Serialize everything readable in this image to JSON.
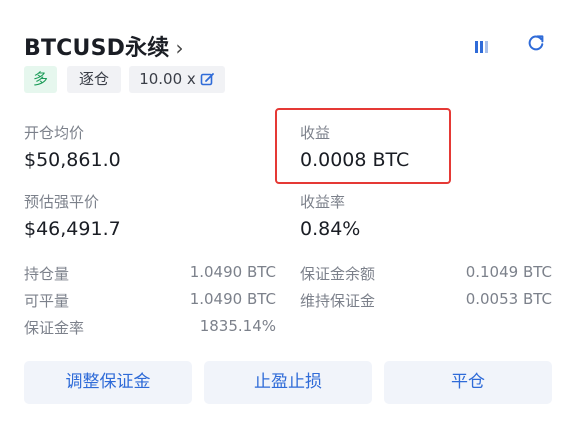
{
  "header": {
    "title": "BTCUSD永续",
    "chevron": "›"
  },
  "tags": {
    "side": "多",
    "margin_mode": "逐仓",
    "leverage": "10.00 x"
  },
  "stats": {
    "open_price_label": "开仓均价",
    "open_price_value": "$50,861.0",
    "pnl_label": "收益",
    "pnl_value": "0.0008 BTC",
    "liq_price_label": "预估强平价",
    "liq_price_value": "$46,491.7",
    "pnl_rate_label": "收益率",
    "pnl_rate_value": "0.84%"
  },
  "details": {
    "position_label": "持仓量",
    "position_value": "1.0490 BTC",
    "closable_label": "可平量",
    "closable_value": "1.0490 BTC",
    "margin_ratio_label": "保证金率",
    "margin_ratio_value": "1835.14%",
    "margin_balance_label": "保证金余额",
    "margin_balance_value": "0.1049 BTC",
    "maint_margin_label": "维持保证金",
    "maint_margin_value": "0.0053 BTC"
  },
  "actions": {
    "adjust_margin": "调整保证金",
    "tp_sl": "止盈止损",
    "close": "平仓"
  },
  "icons": {
    "pause": "pause-bars-icon",
    "refresh": "refresh-icon",
    "edit": "edit-icon"
  },
  "colors": {
    "accent": "#2f6bd8",
    "long_green": "#1a9b57",
    "highlight_red": "#e53935"
  }
}
